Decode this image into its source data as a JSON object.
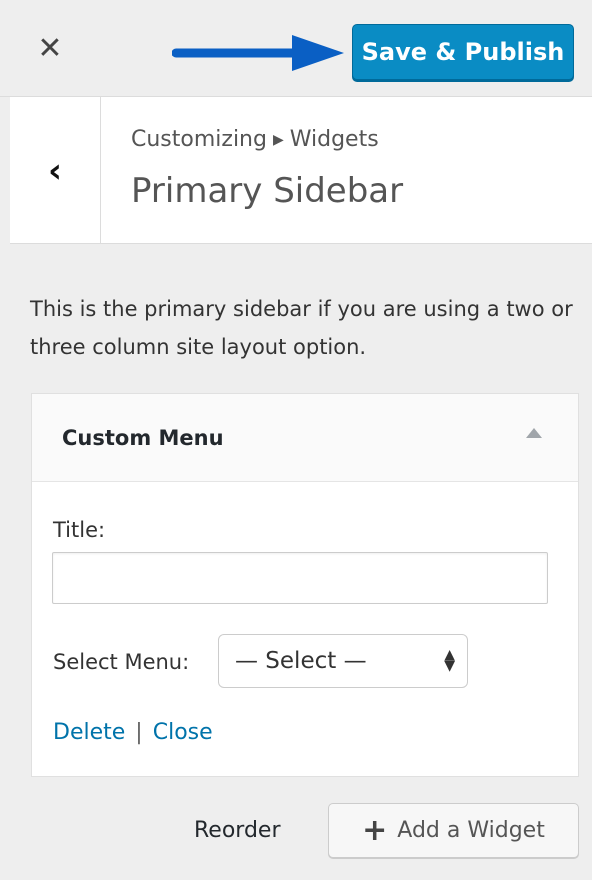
{
  "topbar": {
    "close_icon": "close-icon",
    "close_glyph": "✕",
    "arrow_icon": "arrow-right-icon",
    "save_label": "Save & Publish",
    "accent_color": "#0a8cc4"
  },
  "header": {
    "back_icon": "chevron-left-icon",
    "back_glyph": "‹",
    "breadcrumb": [
      "Customizing",
      "Widgets"
    ],
    "breadcrumb_sep": "▶",
    "title": "Primary Sidebar"
  },
  "description": "This is the primary sidebar if you are using a two or three column site layout option.",
  "widget": {
    "title": "Custom Menu",
    "toggle_icon": "triangle-up-icon",
    "title_field_label": "Title:",
    "title_field_value": "",
    "select_label": "Select Menu:",
    "select_value": "— Select —",
    "delete_label": "Delete",
    "separator": "|",
    "close_label": "Close"
  },
  "footer": {
    "reorder_label": "Reorder",
    "add_widget_label": "Add a Widget",
    "add_icon": "plus-icon",
    "add_glyph": "+"
  }
}
